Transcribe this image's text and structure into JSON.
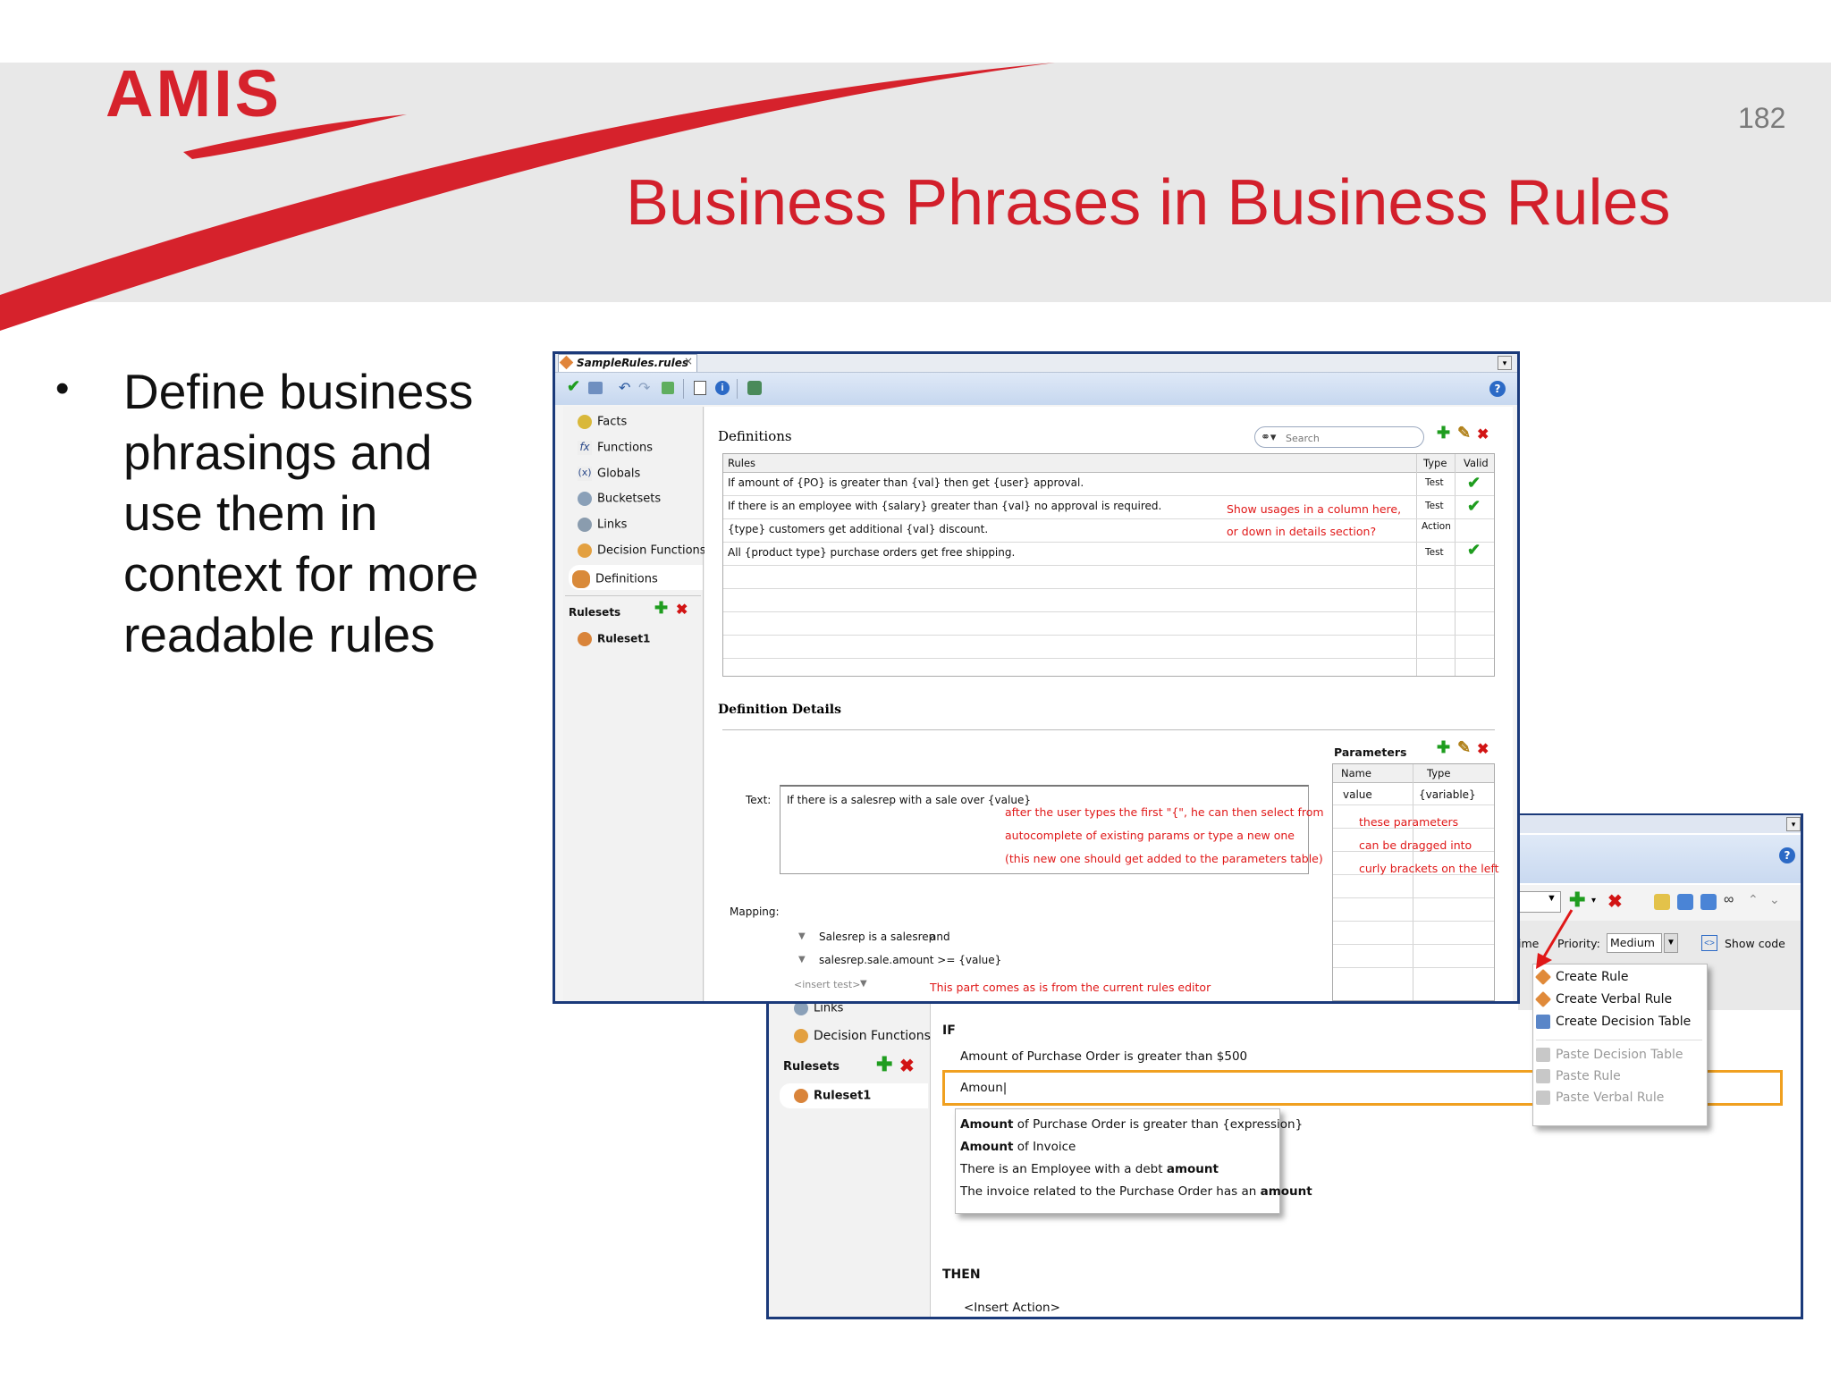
{
  "slide": {
    "logo_text": "AMIS",
    "page_number": "182",
    "title": "Business Phrases in Business Rules",
    "bullet": "Define business phrasings and use them in context for more readable rules"
  },
  "front_window": {
    "tab_label": "SampleRules.rules",
    "tab_close": "×",
    "help_label": "?",
    "nav": {
      "items": [
        "Facts",
        "Functions",
        "Globals",
        "Bucketsets",
        "Links",
        "Decision Functions",
        "Definitions"
      ],
      "rulesets_label": "Rulesets",
      "ruleset_item": "Ruleset1"
    },
    "definitions": {
      "heading": "Definitions",
      "search_placeholder": "Search",
      "columns": [
        "Rules",
        "Type",
        "Valid"
      ],
      "rows": [
        {
          "rule": "If amount of {PO} is greater than {val} then get {user} approval.",
          "type": "Test",
          "valid": "✔"
        },
        {
          "rule": "If there is an employee with {salary} greater than {val} no approval is required.",
          "type": "Test",
          "valid": "✔"
        },
        {
          "rule": "{type} customers get additional {val} discount.",
          "type": "Action",
          "valid": ""
        },
        {
          "rule": "All {product type} purchase orders get free shipping.",
          "type": "Test",
          "valid": "✔"
        }
      ],
      "note_line1": "Show usages in a column here,",
      "note_line2": "or down in details section?"
    },
    "details": {
      "heading": "Definition Details",
      "text_label": "Text:",
      "text_value": "If there is a salesrep with a sale over {value}",
      "text_note1": "after the user types the first \"{\", he can then select from",
      "text_note2": "autocomplete of existing params or type a new one",
      "text_note3": "(this new one should get added to the parameters table)",
      "parameters_label": "Parameters",
      "param_columns": [
        "Name",
        "Type"
      ],
      "param_name": "value",
      "param_type": "{variable}",
      "param_note1": "these parameters",
      "param_note2": "can be dragged into",
      "param_note3": "curly brackets on the left",
      "mapping_label": "Mapping:",
      "mapping_line1": "Salesrep is a salesrep",
      "mapping_and": "and",
      "mapping_line2": "salesrep.sale.amount >= {value}",
      "insert_test": "<insert test>",
      "mapping_note": "This part comes as is from the current rules editor"
    }
  },
  "back_window": {
    "help_label": "?",
    "time_label": "ime",
    "priority_label": "Priority:",
    "priority_value": "Medium",
    "show_code": "Show code",
    "menu": {
      "create_rule": "Create Rule",
      "create_verbal_rule": "Create Verbal Rule",
      "create_decision_table": "Create Decision Table",
      "paste_decision_table": "Paste Decision Table",
      "paste_rule": "Paste Rule",
      "paste_verbal_rule": "Paste Verbal Rule"
    },
    "nav": {
      "links": "Links",
      "decision_functions": "Decision Functions",
      "rulesets_label": "Rulesets",
      "ruleset_item": "Ruleset1"
    },
    "if_label": "IF",
    "if_line": "Amount of Purchase Order is greater than $500",
    "input_value": "Amoun|",
    "suggestions": [
      {
        "bold": "Amount",
        "rest": " of Purchase Order is greater than {expression}"
      },
      {
        "bold": "Amount",
        "rest": " of Invoice"
      },
      {
        "pre": "There is an Employee with a debt ",
        "bold": "amount"
      },
      {
        "pre": "The invoice related to the Purchase Order has an ",
        "bold": "amount"
      }
    ],
    "then_label": "THEN",
    "insert_action": "<Insert Action>"
  },
  "colors": {
    "brand_red": "#d6222c",
    "title_red": "#d21f2b",
    "window_border": "#1b3a7a",
    "highlight_orange": "#f0a020"
  }
}
